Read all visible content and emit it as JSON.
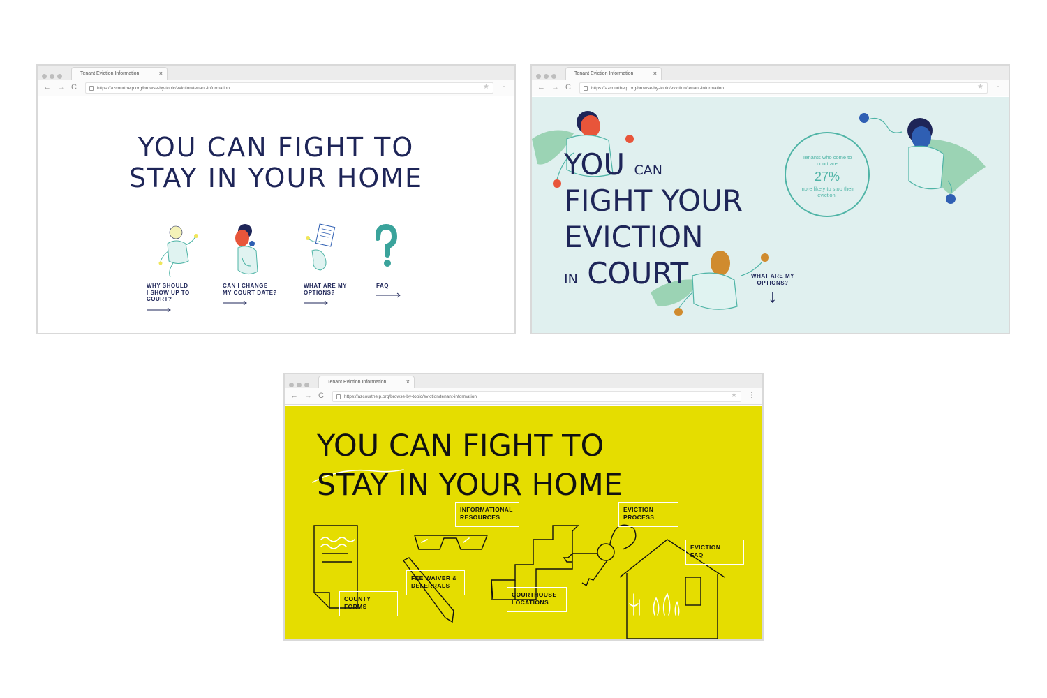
{
  "browser": {
    "tab_title": "Tenant Eviction Information",
    "tab_close": "×",
    "url": "https://azcourthelp.org/browse-by-topic/eviction/tenant-information",
    "nav_back": "←",
    "nav_forward": "→",
    "nav_reload": "C",
    "star": "★",
    "menu": "⋮"
  },
  "screen1": {
    "title_line1": "YOU CAN FIGHT TO",
    "title_line2": "STAY IN YOUR HOME",
    "items": [
      {
        "label": "WHY SHOULD\nI SHOW UP TO\nCOURT?",
        "icon": "person-running-icon"
      },
      {
        "label": "CAN I CHANGE\nMY COURT DATE?",
        "icon": "person-on-phone-icon"
      },
      {
        "label": "WHAT ARE MY\nOPTIONS?",
        "icon": "person-with-document-icon"
      },
      {
        "label": "FAQ",
        "icon": "question-mark-icon"
      }
    ]
  },
  "screen2": {
    "line1_big": "YOU",
    "line1_small": "CAN",
    "line2": "FIGHT YOUR",
    "line3": "EVICTION",
    "line4_small": "IN",
    "line4_big": "COURT",
    "stat_top": "Tenants who come to court are",
    "stat_value": "27%",
    "stat_bottom": "more likely to stop their eviction!",
    "options_label": "WHAT ARE MY OPTIONS?",
    "down_arrow": "↓"
  },
  "screen3": {
    "title_line1": "YOU CAN FIGHT TO",
    "title_line2": "STAY IN YOUR HOME",
    "boxes": {
      "informational": "INFORMATIONAL\nRESOURCES",
      "eviction_process": "EVICTION\nPROCESS",
      "eviction_faq": "EVICTION\nFAQ",
      "fee_waiver": "FEE WAIVER &\nDEFERRALS",
      "county_forms": "COUNTY\nFORMS",
      "courthouse": "COURTHOUSE\nLOCATIONS"
    }
  },
  "colors": {
    "navy": "#1e2558",
    "teal": "#4fb4a6",
    "mint_bg": "#e0f0ef",
    "yellow_bg": "#e5dd00",
    "orange": "#e8553a",
    "blue": "#2f5fb3",
    "ochre": "#d08b2e"
  }
}
